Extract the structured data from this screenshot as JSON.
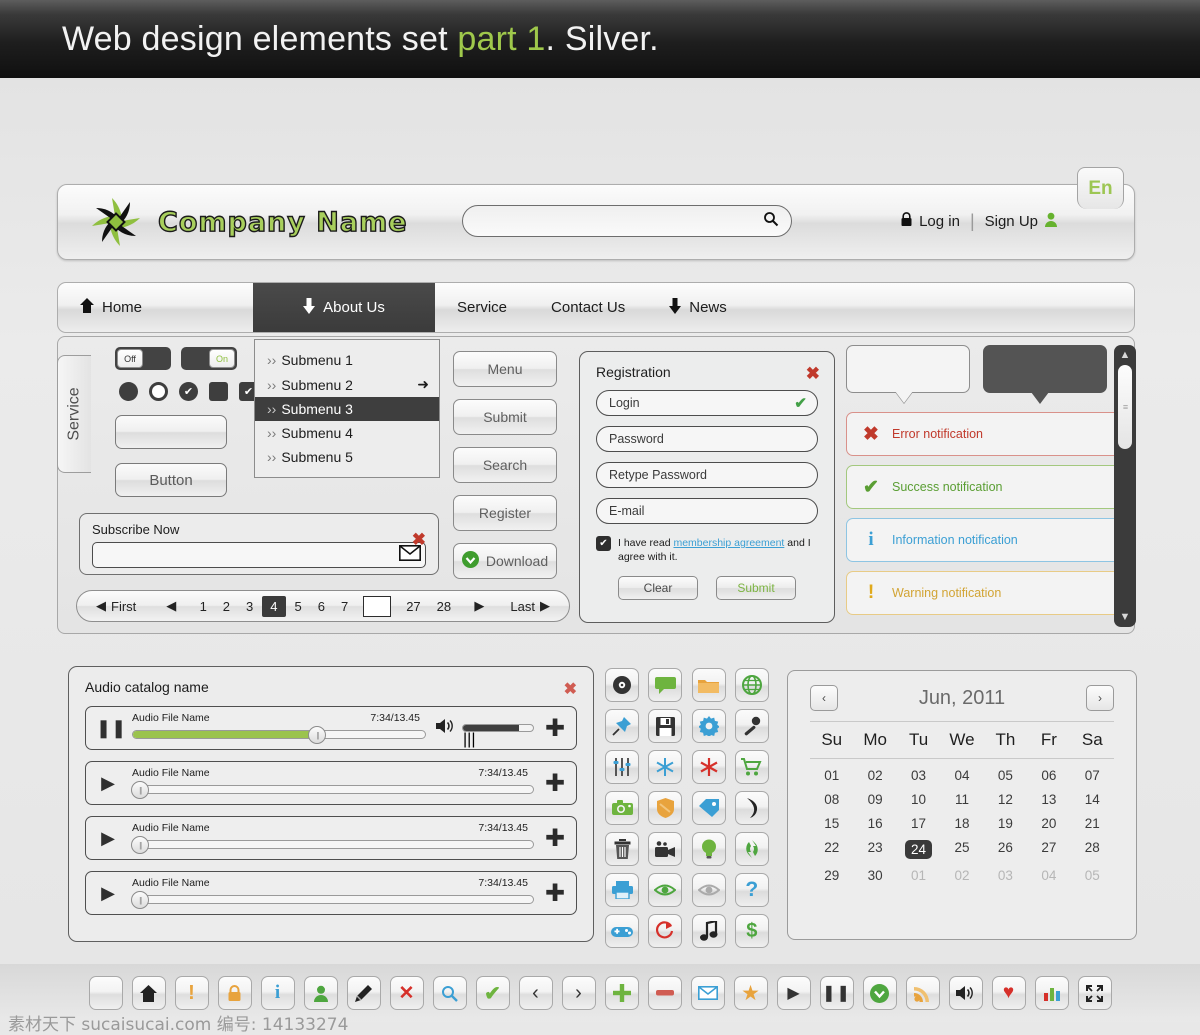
{
  "banner": {
    "text_before": "Web design elements set ",
    "accent": "part 1",
    "text_after": ". Silver.",
    "accent_color": "#9fc84b"
  },
  "header": {
    "company_name": "Company Name",
    "search_placeholder": "",
    "search_value": "",
    "login_label": "Log in",
    "signup_label": "Sign Up",
    "separator": "|",
    "language_badge": "En"
  },
  "nav": {
    "items": [
      {
        "label": "Home",
        "icon": "home-icon",
        "active": false
      },
      {
        "label": "About Us",
        "icon": "down-arrow-icon",
        "active": true
      },
      {
        "label": "Service",
        "icon": "",
        "active": false
      },
      {
        "label": "Contact Us",
        "icon": "",
        "active": false
      },
      {
        "label": "News",
        "icon": "down-arrow-icon",
        "active": false
      }
    ]
  },
  "widgets": {
    "service_tab": "Service",
    "toggle_off": "Off",
    "toggle_on": "On",
    "empty_button": "",
    "button_label": "Button",
    "submenu": [
      {
        "label": "Submenu 1",
        "active": false,
        "arrow": false
      },
      {
        "label": "Submenu 2",
        "active": false,
        "arrow": true
      },
      {
        "label": "Submenu 3",
        "active": true,
        "arrow": false
      },
      {
        "label": "Submenu 4",
        "active": false,
        "arrow": false
      },
      {
        "label": "Submenu 5",
        "active": false,
        "arrow": false
      }
    ],
    "buttons": [
      {
        "label": "Menu",
        "icon": ""
      },
      {
        "label": "Submit",
        "icon": ""
      },
      {
        "label": "Search",
        "icon": ""
      },
      {
        "label": "Register",
        "icon": ""
      },
      {
        "label": "Download",
        "icon": "download-circle-icon"
      }
    ],
    "subscribe": {
      "label": "Subscribe Now",
      "value": "",
      "placeholder": "",
      "button_icon": "envelope-icon"
    },
    "pagination": {
      "first": "First",
      "last": "Last",
      "pages": [
        "1",
        "2",
        "3",
        "4",
        "5",
        "6",
        "7"
      ],
      "active_page": "4",
      "input_value": "",
      "tail_pages": [
        "27",
        "28"
      ]
    }
  },
  "registration": {
    "title": "Registration",
    "fields": [
      {
        "label": "Login",
        "valid": true
      },
      {
        "label": "Password",
        "valid": false
      },
      {
        "label": "Retype Password",
        "valid": false
      },
      {
        "label": "E-mail",
        "valid": false
      }
    ],
    "agree_pre": "I have read ",
    "agree_link": "membership agreement",
    "agree_post": " and I agree with it.",
    "agree_checked": true,
    "clear_label": "Clear",
    "submit_label": "Submit"
  },
  "notifications": [
    {
      "label": "Error notification",
      "icon": "cross-icon",
      "color": "#c0392b",
      "border": "#d9918a",
      "text_color": "#c0392b"
    },
    {
      "label": "Success notification",
      "icon": "check-icon",
      "color": "#5a9e33",
      "border": "#a3c87e",
      "text_color": "#5a9e33"
    },
    {
      "label": "Information notification",
      "icon": "info-icon",
      "color": "#3b9fd4",
      "border": "#8ec5e3",
      "text_color": "#3b9fd4"
    },
    {
      "label": "Warning notification",
      "icon": "exclamation-icon",
      "color": "#e0a91b",
      "border": "#e8cb86",
      "text_color": "#d2a434"
    }
  ],
  "audio": {
    "title": "Audio catalog name",
    "tracks": [
      {
        "name": "Audio File Name",
        "time": "7:34/13.45",
        "state": "pause",
        "progress": 64,
        "has_volume": true,
        "volume": 80
      },
      {
        "name": "Audio File Name",
        "time": "7:34/13.45",
        "state": "play",
        "progress": 0,
        "has_volume": false,
        "volume": 0
      },
      {
        "name": "Audio File Name",
        "time": "7:34/13.45",
        "state": "play",
        "progress": 0,
        "has_volume": false,
        "volume": 0
      },
      {
        "name": "Audio File Name",
        "time": "7:34/13.45",
        "state": "play",
        "progress": 0,
        "has_volume": false,
        "volume": 0
      }
    ]
  },
  "icon_grid": [
    {
      "name": "disc-icon",
      "glyph": "◉",
      "color": "#333333"
    },
    {
      "name": "chat-bubble-icon",
      "glyph": "▭",
      "color": "#6eb43f"
    },
    {
      "name": "folder-icon",
      "glyph": "📁",
      "color": "#e8a33d"
    },
    {
      "name": "globe-icon",
      "glyph": "🌐",
      "color": "#4ea63f"
    },
    {
      "name": "pin-icon",
      "glyph": "📌",
      "color": "#3b9fd4"
    },
    {
      "name": "save-floppy-icon",
      "glyph": "💾",
      "color": "#333333"
    },
    {
      "name": "gear-icon",
      "glyph": "⚙",
      "color": "#3b9fd4"
    },
    {
      "name": "microphone-icon",
      "glyph": "🎤",
      "color": "#333333"
    },
    {
      "name": "equalizer-icon",
      "glyph": "⇅",
      "color": "#555555"
    },
    {
      "name": "snowflake-icon",
      "glyph": "❄",
      "color": "#3b9fd4"
    },
    {
      "name": "asterisk-icon",
      "glyph": "✳",
      "color": "#d6302a"
    },
    {
      "name": "shopping-cart-icon",
      "glyph": "🛒",
      "color": "#4ea63f"
    },
    {
      "name": "camera-icon",
      "glyph": "📷",
      "color": "#6eb43f"
    },
    {
      "name": "shield-icon",
      "glyph": "🛡",
      "color": "#e8a33d"
    },
    {
      "name": "tag-icon",
      "glyph": "🏷",
      "color": "#3b9fd4"
    },
    {
      "name": "phone-icon",
      "glyph": "📞",
      "color": "#222222"
    },
    {
      "name": "trash-icon",
      "glyph": "🗑",
      "color": "#333333"
    },
    {
      "name": "video-camera-icon",
      "glyph": "🎥",
      "color": "#333333"
    },
    {
      "name": "lightbulb-icon",
      "glyph": "💡",
      "color": "#6eb43f"
    },
    {
      "name": "recycle-icon",
      "glyph": "♻",
      "color": "#4ea63f"
    },
    {
      "name": "printer-icon",
      "glyph": "🖨",
      "color": "#3b9fd4"
    },
    {
      "name": "eye-visible-icon",
      "glyph": "👁",
      "color": "#4ea63f"
    },
    {
      "name": "eye-hidden-icon",
      "glyph": "👁",
      "color": "#aaaaaa"
    },
    {
      "name": "question-mark-icon",
      "glyph": "?",
      "color": "#3b9fd4"
    },
    {
      "name": "gamepad-icon",
      "glyph": "🎮",
      "color": "#3b9fd4"
    },
    {
      "name": "refresh-icon",
      "glyph": "↻",
      "color": "#d6302a"
    },
    {
      "name": "music-note-icon",
      "glyph": "♪",
      "color": "#222222"
    },
    {
      "name": "dollar-icon",
      "glyph": "$",
      "color": "#4ea63f"
    }
  ],
  "calendar": {
    "month_label": "Jun, 2011",
    "prev": "‹",
    "next": "›",
    "dow": [
      "Su",
      "Mo",
      "Tu",
      "We",
      "Th",
      "Fr",
      "Sa"
    ],
    "weeks": [
      [
        {
          "d": "01"
        },
        {
          "d": "02"
        },
        {
          "d": "03"
        },
        {
          "d": "04"
        },
        {
          "d": "05"
        },
        {
          "d": "06"
        },
        {
          "d": "07"
        }
      ],
      [
        {
          "d": "08"
        },
        {
          "d": "09"
        },
        {
          "d": "10"
        },
        {
          "d": "11"
        },
        {
          "d": "12"
        },
        {
          "d": "13"
        },
        {
          "d": "14"
        }
      ],
      [
        {
          "d": "15"
        },
        {
          "d": "16"
        },
        {
          "d": "17"
        },
        {
          "d": "18"
        },
        {
          "d": "19"
        },
        {
          "d": "20"
        },
        {
          "d": "21"
        }
      ],
      [
        {
          "d": "22"
        },
        {
          "d": "23"
        },
        {
          "d": "24",
          "sel": true
        },
        {
          "d": "25"
        },
        {
          "d": "26"
        },
        {
          "d": "27"
        },
        {
          "d": "28"
        }
      ],
      [
        {
          "d": "29"
        },
        {
          "d": "30"
        },
        {
          "d": "01",
          "muted": true
        },
        {
          "d": "02",
          "muted": true
        },
        {
          "d": "03",
          "muted": true
        },
        {
          "d": "04",
          "muted": true
        },
        {
          "d": "05",
          "muted": true
        }
      ]
    ],
    "selected_day": "24"
  },
  "toolbar": [
    {
      "name": "blank-button-icon",
      "glyph": "",
      "color": "#333"
    },
    {
      "name": "home-icon",
      "glyph": "⌂",
      "color": "#222"
    },
    {
      "name": "exclamation-icon",
      "glyph": "!",
      "color": "#e8a33d"
    },
    {
      "name": "lock-icon",
      "glyph": "🔒",
      "color": "#e8a33d"
    },
    {
      "name": "info-icon",
      "glyph": "i",
      "color": "#3b9fd4"
    },
    {
      "name": "user-icon",
      "glyph": "👤",
      "color": "#4ea63f"
    },
    {
      "name": "pencil-icon",
      "glyph": "✎",
      "color": "#222"
    },
    {
      "name": "close-x-icon",
      "glyph": "✕",
      "color": "#d6302a"
    },
    {
      "name": "search-icon",
      "glyph": "🔍",
      "color": "#3b9fd4"
    },
    {
      "name": "check-icon",
      "glyph": "✔",
      "color": "#6eb43f"
    },
    {
      "name": "chevron-left-icon",
      "glyph": "‹",
      "color": "#333"
    },
    {
      "name": "chevron-right-icon",
      "glyph": "›",
      "color": "#333"
    },
    {
      "name": "plus-icon",
      "glyph": "✚",
      "color": "#6eb43f"
    },
    {
      "name": "minus-icon",
      "glyph": "▬",
      "color": "#d05c52"
    },
    {
      "name": "envelope-icon",
      "glyph": "✉",
      "color": "#3b9fd4"
    },
    {
      "name": "star-icon",
      "glyph": "★",
      "color": "#e8a33d"
    },
    {
      "name": "play-icon",
      "glyph": "▶",
      "color": "#333"
    },
    {
      "name": "pause-icon",
      "glyph": "❚❚",
      "color": "#333"
    },
    {
      "name": "download-circle-icon",
      "glyph": "⌄",
      "color": "#4ea63f"
    },
    {
      "name": "rss-icon",
      "glyph": "📶",
      "color": "#e8a33d"
    },
    {
      "name": "volume-icon",
      "glyph": "🔊",
      "color": "#333"
    },
    {
      "name": "heart-icon",
      "glyph": "♥",
      "color": "#d6302a"
    },
    {
      "name": "bar-chart-icon",
      "glyph": "▮",
      "color": "#4ea63f"
    },
    {
      "name": "fullscreen-icon",
      "glyph": "⛶",
      "color": "#333"
    }
  ],
  "footer": {
    "note": "素材天下 sucaisucai.com 编号: 14133274"
  }
}
